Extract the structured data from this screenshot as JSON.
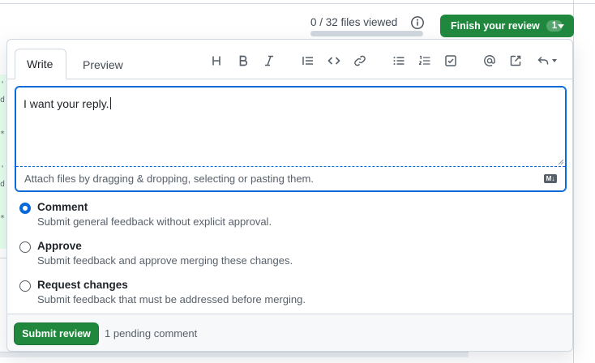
{
  "header": {
    "files_viewed": "0 / 32 files viewed",
    "progress_fraction": 0,
    "finish_label": "Finish your review",
    "finish_count": "1"
  },
  "tabs": {
    "write": "Write",
    "preview": "Preview"
  },
  "toolbar": [
    "heading-icon",
    "bold-icon",
    "italic-icon",
    "quote-icon",
    "code-icon",
    "link-icon",
    "bulleted-list-icon",
    "numbered-list-icon",
    "task-list-icon",
    "mention-icon",
    "cross-reference-icon",
    "reply-icon"
  ],
  "editor": {
    "value": "I want your reply.",
    "attach_text": "Attach files by dragging & dropping, selecting or pasting them.",
    "markdown_badge": "M↓"
  },
  "options": [
    {
      "label": "Comment",
      "description": "Submit general feedback without explicit approval.",
      "checked": true
    },
    {
      "label": "Approve",
      "description": "Submit feedback and approve merging these changes.",
      "checked": false
    },
    {
      "label": "Request changes",
      "description": "Submit feedback that must be addressed before merging.",
      "checked": false
    }
  ],
  "footer": {
    "submit_label": "Submit review",
    "pending_text": "1 pending comment"
  },
  "colors": {
    "primary": "#1f883d",
    "focus": "#0969da",
    "muted": "#57606a",
    "border": "#d0d7de"
  }
}
